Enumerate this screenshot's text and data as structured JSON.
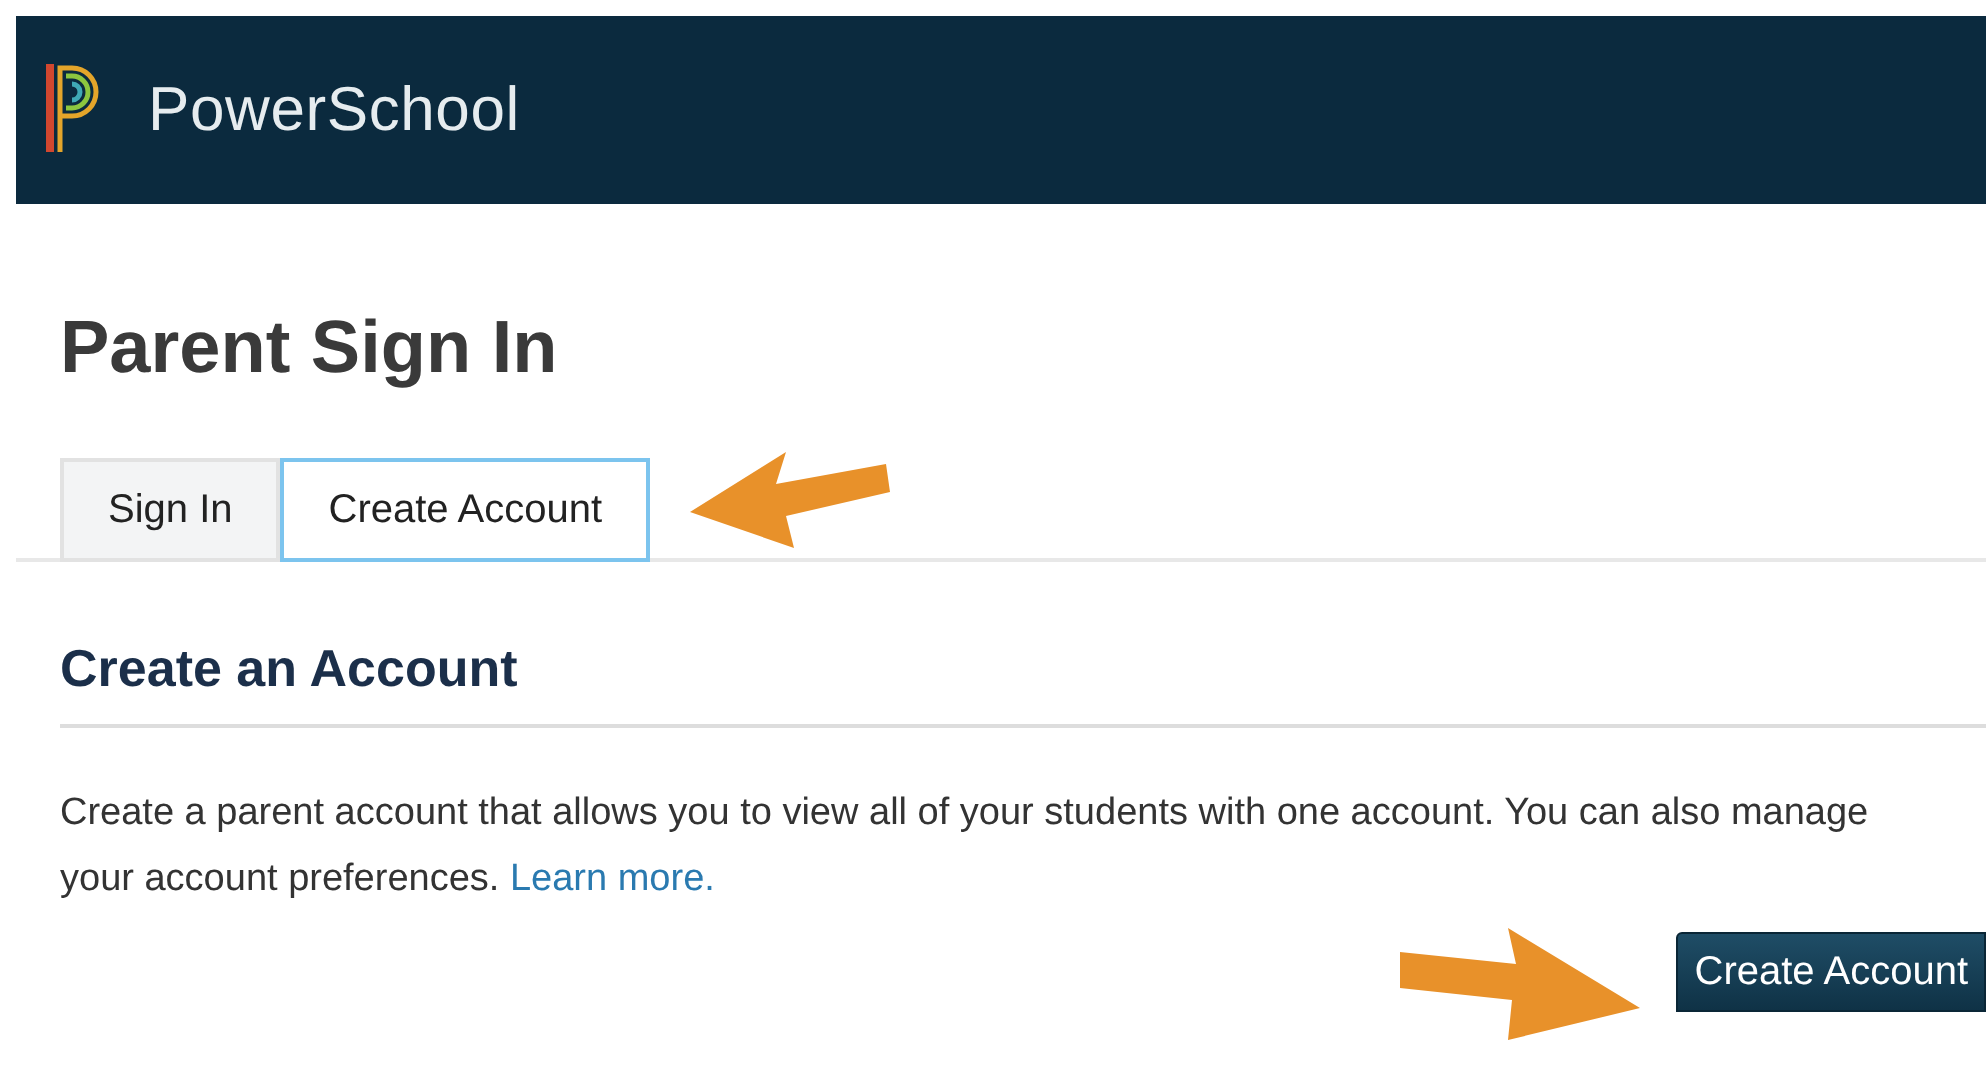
{
  "header": {
    "brand": "PowerSchool"
  },
  "page_title": "Parent Sign In",
  "tabs": [
    {
      "label": "Sign In",
      "selected": false
    },
    {
      "label": "Create Account",
      "selected": true
    }
  ],
  "section": {
    "heading": "Create an Account",
    "text": "Create a parent account that allows you to view all of your students with one account. You can also manage your account preferences.",
    "link": "Learn more."
  },
  "buttons": [
    "Create Account"
  ]
}
